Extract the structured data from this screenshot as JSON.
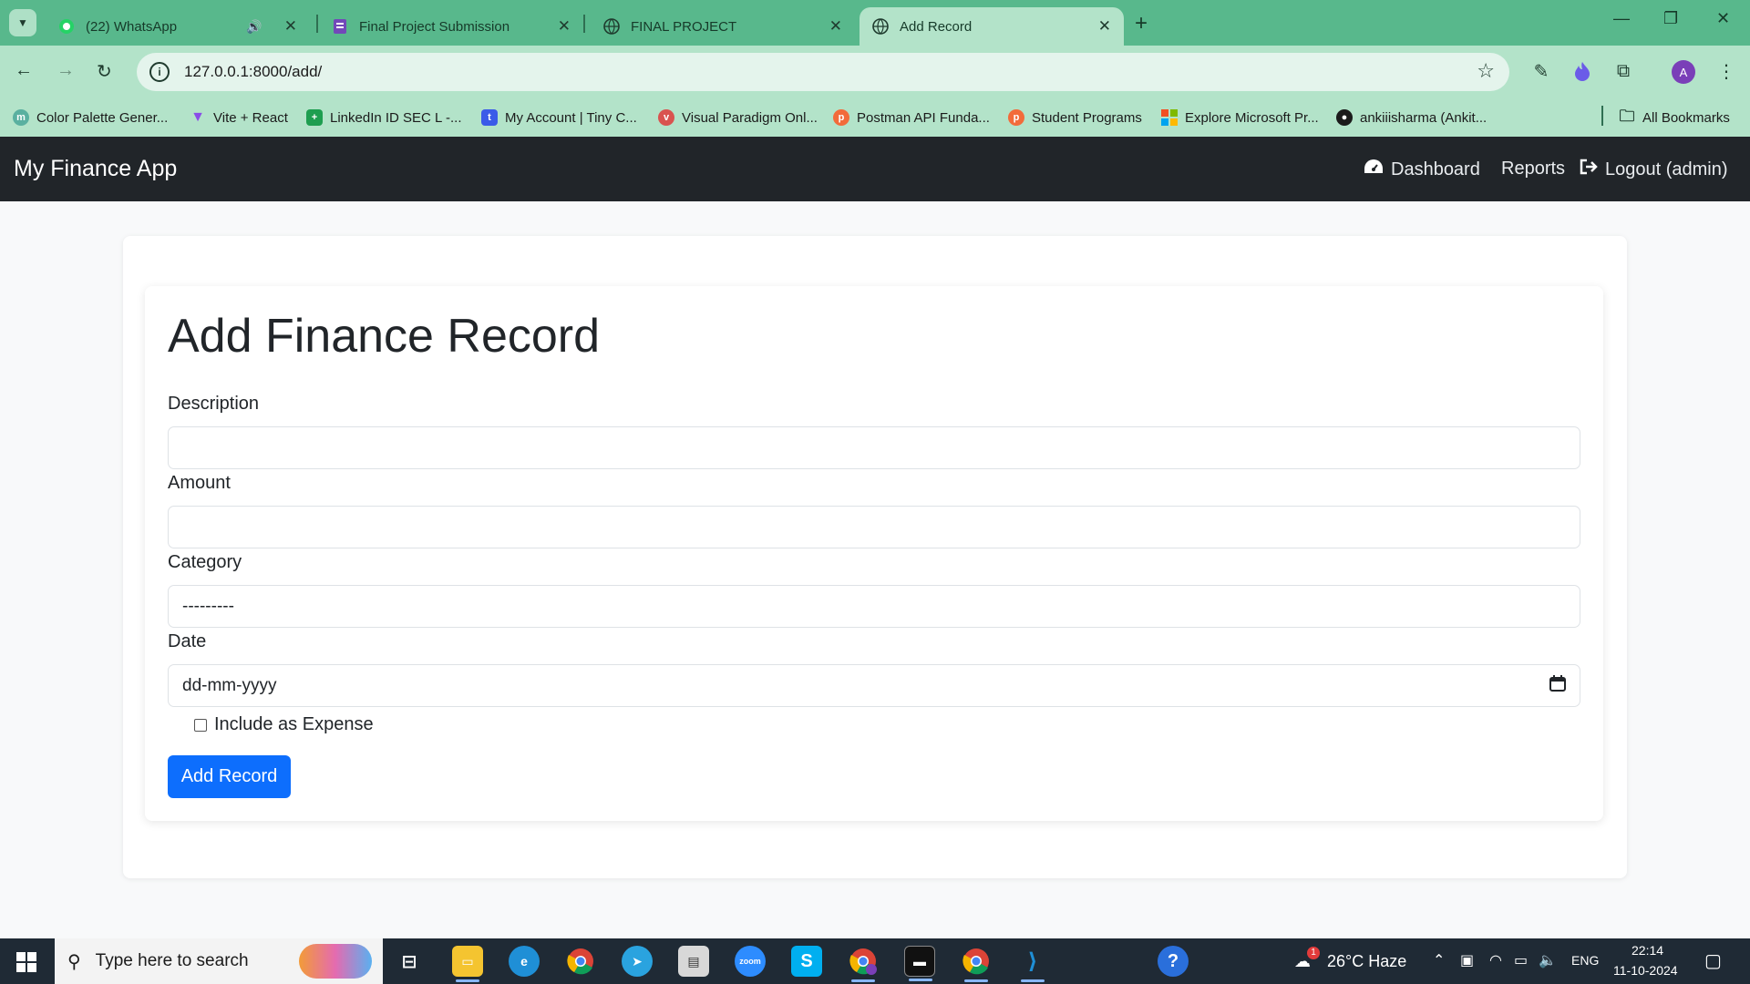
{
  "browser": {
    "tabs": [
      {
        "title": "(22) WhatsApp",
        "icon": "whatsapp-icon"
      },
      {
        "title": "Final Project Submission",
        "icon": "forms-icon"
      },
      {
        "title": "FINAL PROJECT",
        "icon": "globe-icon"
      },
      {
        "title": "Add Record",
        "icon": "globe-icon",
        "active": true
      }
    ],
    "url": "127.0.0.1:8000/add/",
    "bookmarks": [
      {
        "label": "Color Palette Gener...",
        "icon": "palette-icon"
      },
      {
        "label": "Vite + React",
        "icon": "vite-icon"
      },
      {
        "label": "LinkedIn ID SEC L -...",
        "icon": "sheets-icon"
      },
      {
        "label": "My Account | Tiny C...",
        "icon": "tiny-icon"
      },
      {
        "label": "Visual Paradigm Onl...",
        "icon": "vp-icon"
      },
      {
        "label": "Postman API Funda...",
        "icon": "postman-icon"
      },
      {
        "label": "Student Programs",
        "icon": "postman-icon"
      },
      {
        "label": "Explore Microsoft Pr...",
        "icon": "microsoft-icon"
      },
      {
        "label": "ankiiisharma (Ankit...",
        "icon": "github-icon"
      }
    ],
    "all_bookmarks": "All Bookmarks",
    "profile_initial": "A"
  },
  "app": {
    "brand": "My Finance App",
    "nav": {
      "dashboard": "Dashboard",
      "reports": "Reports",
      "logout": "Logout (admin)"
    }
  },
  "form": {
    "title": "Add Finance Record",
    "description_label": "Description",
    "amount_label": "Amount",
    "category_label": "Category",
    "category_value": "---------",
    "date_label": "Date",
    "date_placeholder": "dd-mm-yyyy",
    "expense_label": "Include as Expense",
    "submit_label": "Add Record"
  },
  "taskbar": {
    "search_placeholder": "Type here to search",
    "weather": "26°C  Haze",
    "language": "ENG",
    "time": "22:14",
    "date": "11-10-2024",
    "weather_badge": "1"
  },
  "colors": {
    "chrome_green": "#58b88c",
    "navbar_dark": "#212529",
    "primary": "#0d6efd"
  }
}
